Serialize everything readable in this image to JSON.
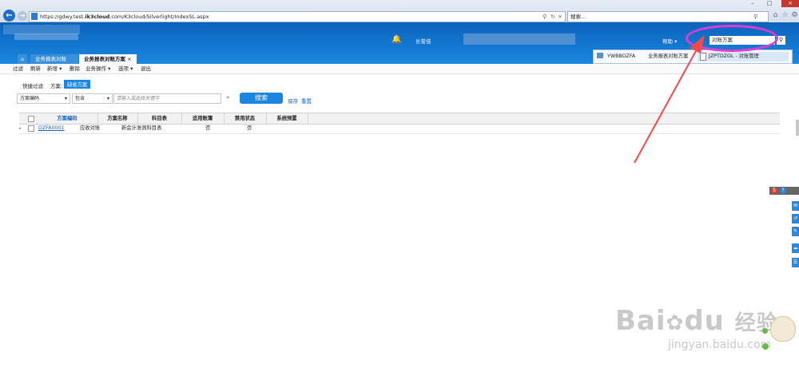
{
  "browser": {
    "url_prefix": "https://gdwy.test.",
    "url_bold": "ik3cloud",
    "url_suffix": ".com/K3cloud/Silverlight/IndexSL.aspx",
    "search_placeholder": "搜索..."
  },
  "header": {
    "user_name": "长誉佳",
    "help_label": "帮助",
    "search_value": "对账方案"
  },
  "tabs": [
    {
      "label": "业务报表对账"
    },
    {
      "label": "业务报表对账方案"
    }
  ],
  "search_popup": {
    "item1_code": "YWBBDZFA",
    "item1_name": "业务报表对账方案",
    "item2_code": "JZPTDZGL",
    "item2_name": "对账管理"
  },
  "toolbar": {
    "items": [
      "过滤",
      "刷新",
      "新增",
      "删除",
      "业务操作",
      "选项",
      "退出"
    ]
  },
  "filter": {
    "quick_label": "快捷过滤",
    "scheme_label": "方案:",
    "default_scheme": "缺省方案",
    "field_select": "方案编码",
    "op_select": "包含",
    "keyword_placeholder": "请输入或选择关键字",
    "search_button": "搜索",
    "save_link": "保存",
    "reset_link": "重置"
  },
  "grid": {
    "headers": [
      "方案编码",
      "方案名称",
      "科目表",
      "适用账簿",
      "禁用状态",
      "系统预置"
    ],
    "rows": [
      [
        "DZFA0001",
        "应收对账",
        "新会计准则科目表",
        "",
        "否",
        "否"
      ]
    ]
  },
  "watermark": {
    "brand": "Bai",
    "brand2": "du",
    "cn": "经验",
    "url": "jingyan.baidu.com"
  },
  "colors": {
    "header_blue": "#1778d2",
    "arrow_red": "#f04a4a",
    "ellipse_magenta": "#e23bd4"
  }
}
